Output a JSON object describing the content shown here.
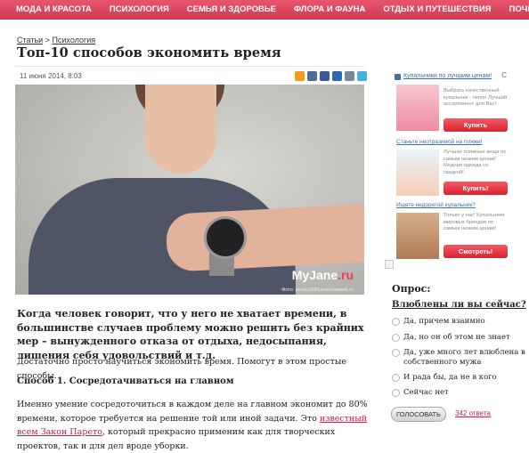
{
  "nav": {
    "items": [
      "МОДА И КРАСОТА",
      "ПСИХОЛОГИЯ",
      "СЕМЬЯ И ЗДОРОВЬЕ",
      "ФЛОРА И ФАУНА",
      "ОТДЫХ И ПУТЕШЕСТВИЯ",
      "ПОЧИТАЙ"
    ]
  },
  "breadcrumb": {
    "home": "Статьи",
    "sep": " > ",
    "section": "Психология"
  },
  "article": {
    "title": "Топ-10 способов экономить время",
    "date": "11 июня 2014, 8:03",
    "share_icons": [
      {
        "name": "odnoklassniki-icon",
        "color": "#f59a1c"
      },
      {
        "name": "vk-icon",
        "color": "#4b6d96"
      },
      {
        "name": "facebook-icon",
        "color": "#3b5998"
      },
      {
        "name": "mailru-icon",
        "color": "#2a6ab5"
      },
      {
        "name": "livejournal-icon",
        "color": "#7a8896"
      },
      {
        "name": "twitter-icon",
        "color": "#45b0e3"
      }
    ],
    "photo": {
      "logo_main": "MyJane",
      "logo_suffix": ".ru",
      "credit": "Фото: powie15/Rusmediabank.ru"
    },
    "lead": "Когда человек говорит, что у него не хватает времени, в большинстве случаев проблему можно решить без крайних мер – вынужденного отказа от отдыха, недосыпания, лишения себя удовольствий и т.д.",
    "para1": "Достаточно просто научиться экономить время. Помогут в этом простые способы.",
    "heading1": "Способ 1. Сосредотачиваться на главном",
    "para2_before": "Именно умение сосредоточиться в каждом деле на главном экономит до 80% времени, которое требуется на решение той или иной задачи. Это ",
    "para2_link": "известный всем Закон Парето",
    "para2_after": ", который прекрасно применим как для творческих проектов, так и для дел вроде уборки."
  },
  "ad": {
    "header": "Купальники по лучшим ценам!",
    "refresh": "C",
    "items": [
      {
        "title": "",
        "text": "Выбрать качественный купальник - легко! Лучший ассортимент для Вас!",
        "button": "Купить"
      },
      {
        "title": "Станьте неотразимой на пляже!",
        "text": "Лучшие пляжные вещи по самым низким ценам! Модная одежда со скидкой!",
        "button": "Купить!"
      },
      {
        "title": "Ищете недорогой купальник?",
        "text": "Только у нас! Купальники мировых брендов по самым низким ценам!",
        "button": "Смотреть!"
      }
    ]
  },
  "poll": {
    "heading": "Опрос:",
    "question": "Влюблены ли вы сейчас?",
    "options": [
      "Да, причем взаимно",
      "Да, но он об этом не знает",
      "Да, уже много лет влюблена в собственного мужа",
      "И рада бы, да не в кого",
      "Сейчас нет"
    ],
    "vote_label": "ГОЛОСОВАТЬ",
    "answers": "342 ответа"
  }
}
